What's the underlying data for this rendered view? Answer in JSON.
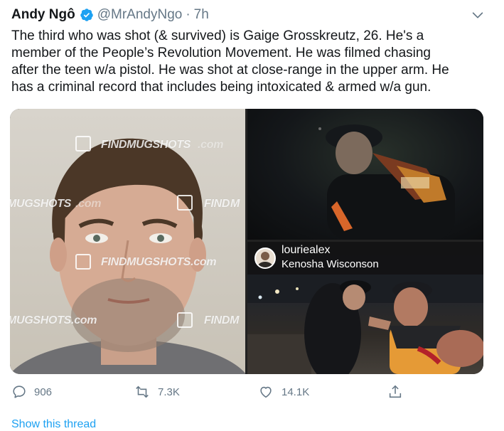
{
  "tweet": {
    "author_name": "Andy Ngô",
    "handle": "@MrAndyNgo",
    "separator": "·",
    "time": "7h",
    "body_lines": [
      "The third who was shot (& survived) is Gaige Grosskreutz, 26. He's a",
      "member of the People’s Revolution Movement. He was filmed chasing",
      "after the teen w/a pistol. He was shot at close-range in the upper arm. He",
      "has a criminal record that includes being intoxicated & armed w/a gun."
    ],
    "media": {
      "watermarks": [
        "FINDMUGSHOTS",
        ".com",
        "MUGSHOTS",
        ".com",
        "FIND",
        "M",
        "FINDMUGSHOTS.com",
        "MUGSHOTS.com",
        "FINDM"
      ],
      "instagram": {
        "username": "louriealex",
        "location": "Kenosha Wisconson"
      }
    },
    "actions": {
      "reply_count": "906",
      "retweet_count": "7.3K",
      "like_count": "14.1K"
    },
    "thread_link": "Show this thread"
  },
  "colors": {
    "verified": "#1da1f2",
    "muted": "#657786",
    "link": "#1da1f2"
  }
}
